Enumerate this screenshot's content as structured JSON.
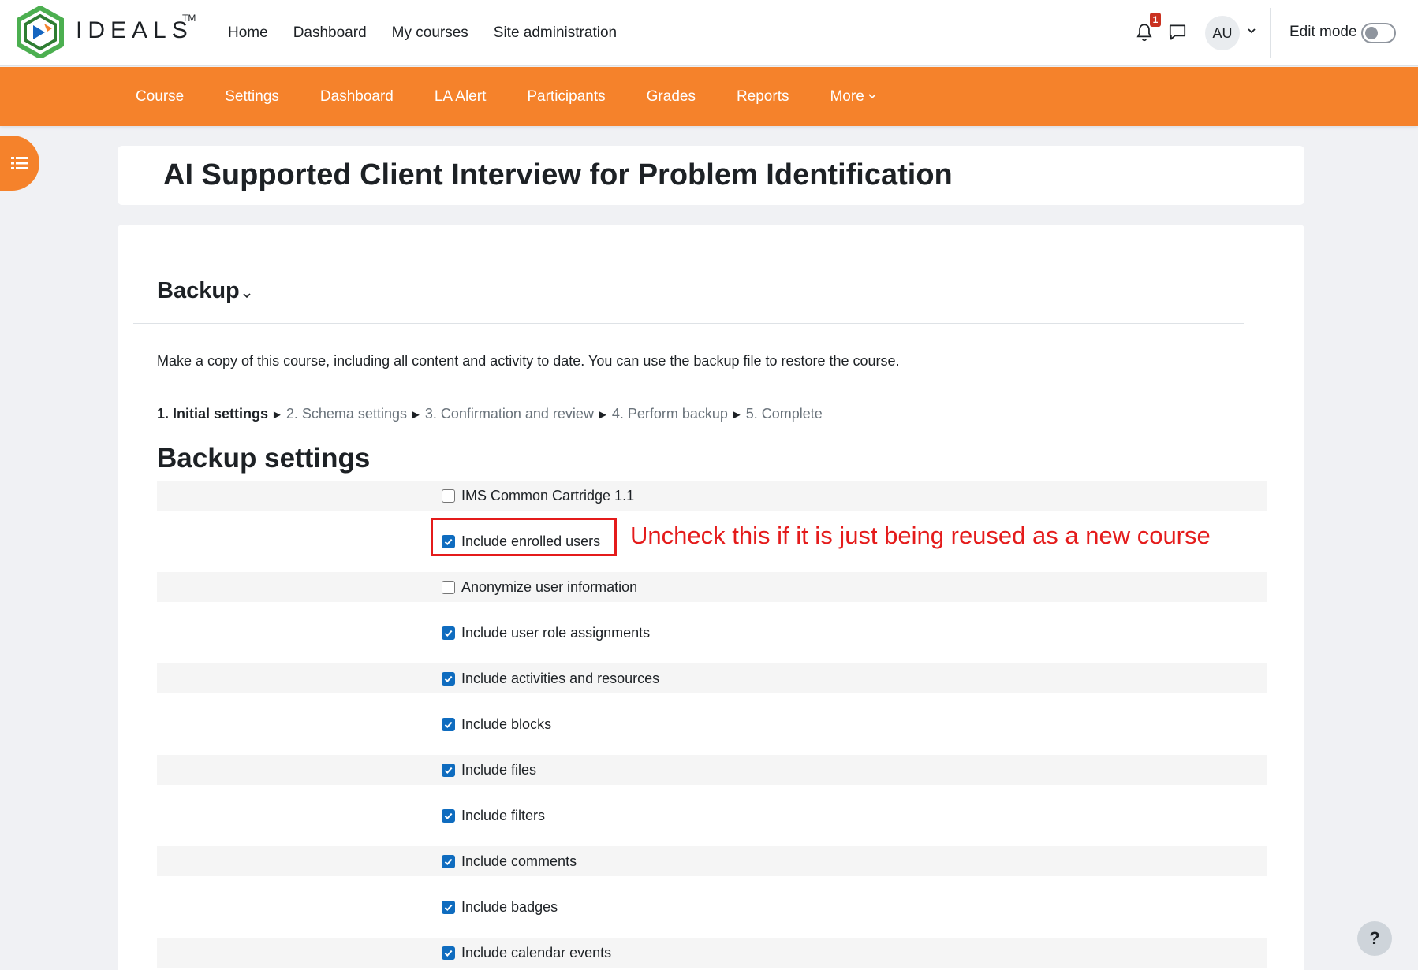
{
  "brand": {
    "name": "IDEALS",
    "trademark": "TM",
    "colors": {
      "orange": "#f5822b",
      "green": "#4caf50",
      "blue": "#0f6cbf",
      "annotation_red": "#e41b1b"
    }
  },
  "topnav": {
    "items": [
      "Home",
      "Dashboard",
      "My courses",
      "Site administration"
    ]
  },
  "notifications": {
    "count": "1",
    "icon": "bell-icon"
  },
  "messages": {
    "icon": "chat-icon"
  },
  "user": {
    "initials": "AU"
  },
  "edit_mode": {
    "label": "Edit mode",
    "enabled": false
  },
  "secnav": {
    "items": [
      "Course",
      "Settings",
      "Dashboard",
      "LA Alert",
      "Participants",
      "Grades",
      "Reports"
    ],
    "more": "More"
  },
  "page": {
    "title": "AI Supported Client Interview for Problem Identification"
  },
  "section": {
    "title": "Backup",
    "description": "Make a copy of this course, including all content and activity to date. You can use the backup file to restore the course.",
    "steps": [
      "1. Initial settings",
      "2. Schema settings",
      "3. Confirmation and review",
      "4. Perform backup",
      "5. Complete"
    ],
    "step_separator": "►"
  },
  "backup_settings": {
    "title": "Backup settings",
    "options": [
      {
        "label": "IMS Common Cartridge 1.1",
        "checked": false
      },
      {
        "label": "Include enrolled users",
        "checked": true
      },
      {
        "label": "Anonymize user information",
        "checked": false
      },
      {
        "label": "Include user role assignments",
        "checked": true
      },
      {
        "label": "Include activities and resources",
        "checked": true
      },
      {
        "label": "Include blocks",
        "checked": true
      },
      {
        "label": "Include files",
        "checked": true
      },
      {
        "label": "Include filters",
        "checked": true
      },
      {
        "label": "Include comments",
        "checked": true
      },
      {
        "label": "Include badges",
        "checked": true
      },
      {
        "label": "Include calendar events",
        "checked": true
      }
    ]
  },
  "annotation": {
    "text": "Uncheck this if it is just being reused as a new course"
  },
  "help": {
    "label": "?"
  }
}
